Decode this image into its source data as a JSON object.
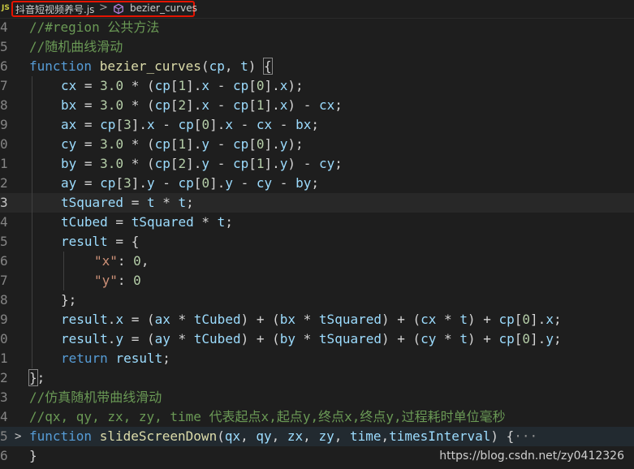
{
  "breadcrumb": {
    "file_icon": "JS",
    "file_name": "抖音短视频养号.js",
    "separator": ">",
    "symbol_icon": "symbol-method-icon",
    "symbol_name": "bezier_curves",
    "highlight_color": "#e51400"
  },
  "gutter": [
    "4",
    "5",
    "6",
    "7",
    "8",
    "9",
    "0",
    "1",
    "2",
    "3",
    "4",
    "5",
    "6",
    "7",
    "8",
    "9",
    "0",
    "1",
    "2",
    "3",
    "4",
    "5",
    "6"
  ],
  "code": {
    "l4_comment": "//#region 公共方法",
    "l5_comment": "//随机曲线滑动",
    "l6_kw": "function",
    "l6_fn": "bezier_curves",
    "l6_open": "(",
    "l6_p1": "cp",
    "l6_comma": ", ",
    "l6_p2": "t",
    "l6_close": ") ",
    "l6_brace": "{",
    "l7": [
      "cx",
      " = ",
      "3.0",
      " * (",
      "cp",
      "[",
      "1",
      "].",
      "x",
      " - ",
      "cp",
      "[",
      "0",
      "].",
      "x",
      ");"
    ],
    "l8": [
      "bx",
      " = ",
      "3.0",
      " * (",
      "cp",
      "[",
      "2",
      "].",
      "x",
      " - ",
      "cp",
      "[",
      "1",
      "].",
      "x",
      ") - ",
      "cx",
      ";"
    ],
    "l9": [
      "ax",
      " = ",
      "cp",
      "[",
      "3",
      "].",
      "x",
      " - ",
      "cp",
      "[",
      "0",
      "].",
      "x",
      " - ",
      "cx",
      " - ",
      "bx",
      ";"
    ],
    "l10": [
      "cy",
      " = ",
      "3.0",
      " * (",
      "cp",
      "[",
      "1",
      "].",
      "y",
      " - ",
      "cp",
      "[",
      "0",
      "].",
      "y",
      ");"
    ],
    "l11": [
      "by",
      " = ",
      "3.0",
      " * (",
      "cp",
      "[",
      "2",
      "].",
      "y",
      " - ",
      "cp",
      "[",
      "1",
      "].",
      "y",
      ") - ",
      "cy",
      ";"
    ],
    "l12": [
      "ay",
      " = ",
      "cp",
      "[",
      "3",
      "].",
      "y",
      " - ",
      "cp",
      "[",
      "0",
      "].",
      "y",
      " - ",
      "cy",
      " - ",
      "by",
      ";"
    ],
    "l13": [
      "tSquared",
      " = ",
      "t",
      " * ",
      "t",
      ";"
    ],
    "l14": [
      "tCubed",
      " = ",
      "tSquared",
      " * ",
      "t",
      ";"
    ],
    "l15": [
      "result",
      " = {"
    ],
    "l16": [
      "\"x\"",
      ": ",
      "0",
      ","
    ],
    "l17": [
      "\"y\"",
      ": ",
      "0"
    ],
    "l18": "};",
    "l19": [
      "result",
      ".",
      "x",
      " = (",
      "ax",
      " * ",
      "tCubed",
      ") + (",
      "bx",
      " * ",
      "tSquared",
      ") + (",
      "cx",
      " * ",
      "t",
      ") + ",
      "cp",
      "[",
      "0",
      "].",
      "x",
      ";"
    ],
    "l20": [
      "result",
      ".",
      "y",
      " = (",
      "ay",
      " * ",
      "tCubed",
      ") + (",
      "by",
      " * ",
      "tSquared",
      ") + (",
      "cy",
      " * ",
      "t",
      ") + ",
      "cp",
      "[",
      "0",
      "].",
      "y",
      ";"
    ],
    "l21": [
      "return",
      " ",
      "result",
      ";"
    ],
    "l22_brace": "}",
    "l22_semi": ";",
    "l23_comment": "//仿真随机带曲线滑动",
    "l24_comment": "//qx, qy, zx, zy, time 代表起点x,起点y,终点x,终点y,过程耗时单位毫秒",
    "l25": [
      "function",
      " ",
      "slideScreenDown",
      "(",
      "qx",
      ", ",
      "qy",
      ", ",
      "zx",
      ", ",
      "zy",
      ", ",
      "time",
      ",",
      "timesInterval",
      ") {",
      "···"
    ],
    "l26": "}"
  },
  "fold_icon": "chevron-right-icon",
  "fold_glyph": ">",
  "watermark": "https://blog.csdn.net/zy0412326"
}
